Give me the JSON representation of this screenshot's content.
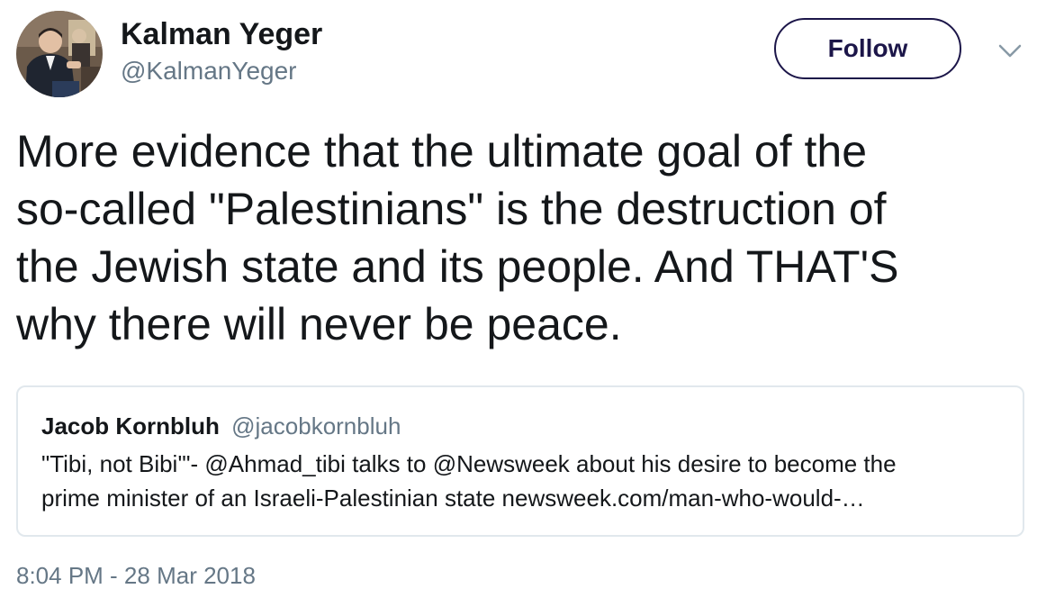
{
  "author": {
    "name": "Kalman Yeger",
    "handle": "@KalmanYeger",
    "avatar_icon": "profile-photo"
  },
  "actions": {
    "follow_label": "Follow",
    "menu_icon": "chevron-down-icon"
  },
  "tweet": {
    "text_lines": [
      "More evidence that the ultimate goal of the",
      "so-called \"Palestinians\" is the destruction of",
      "the Jewish state and its people.  And THAT'S",
      "why there will never be peace."
    ],
    "timestamp": "8:04 PM - 28 Mar 2018"
  },
  "quoted_tweet": {
    "name": "Jacob Kornbluh",
    "handle": "@jacobkornbluh",
    "text_lines": [
      "\"Tibi, not Bibi'\"- @Ahmad_tibi talks to @Newsweek about his desire to become the",
      "prime minister of an Israeli-Palestinian state newsweek.com/man-who-would-…"
    ]
  },
  "colors": {
    "text": "#14171a",
    "secondary": "#657786",
    "follow_border": "#1c1649",
    "card_border": "#e1e8ed"
  }
}
